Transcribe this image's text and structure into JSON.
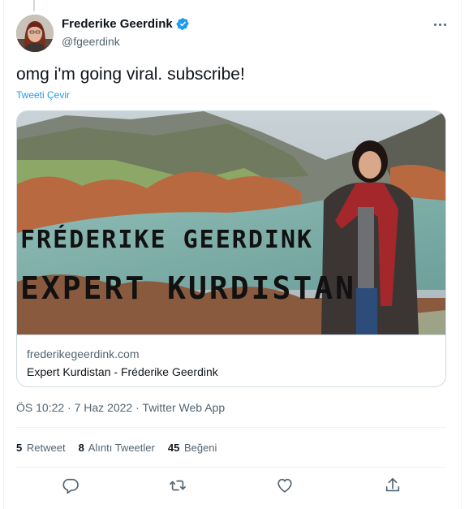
{
  "author": {
    "name": "Frederike Geerdink",
    "handle": "@fgeerdink",
    "verified": true
  },
  "tweet": {
    "text": "omg i'm going viral. subscribe!",
    "translate_label": "Tweeti Çevir"
  },
  "card": {
    "overlay_line1": "FRÉDERIKE GEERDINK",
    "overlay_line2": "EXPERT KURDISTAN",
    "domain": "frederikegeerdink.com",
    "title": "Expert Kurdistan - Fréderike Geerdink"
  },
  "meta": {
    "time": "ÖS 10:22",
    "date": "7 Haz 2022",
    "source": "Twitter Web App",
    "separator": "·"
  },
  "stats": {
    "retweets_count": "5",
    "retweets_label": "Retweet",
    "quotes_count": "8",
    "quotes_label": "Alıntı Tweetler",
    "likes_count": "45",
    "likes_label": "Beğeni"
  },
  "icons": {
    "more": "more-icon",
    "verified": "verified-badge-icon",
    "reply": "reply-icon",
    "retweet": "retweet-icon",
    "like": "heart-icon",
    "share": "share-icon"
  },
  "colors": {
    "accent": "#1d9bf0",
    "muted": "#536471",
    "text": "#0f1419",
    "border": "#cfd9de"
  }
}
